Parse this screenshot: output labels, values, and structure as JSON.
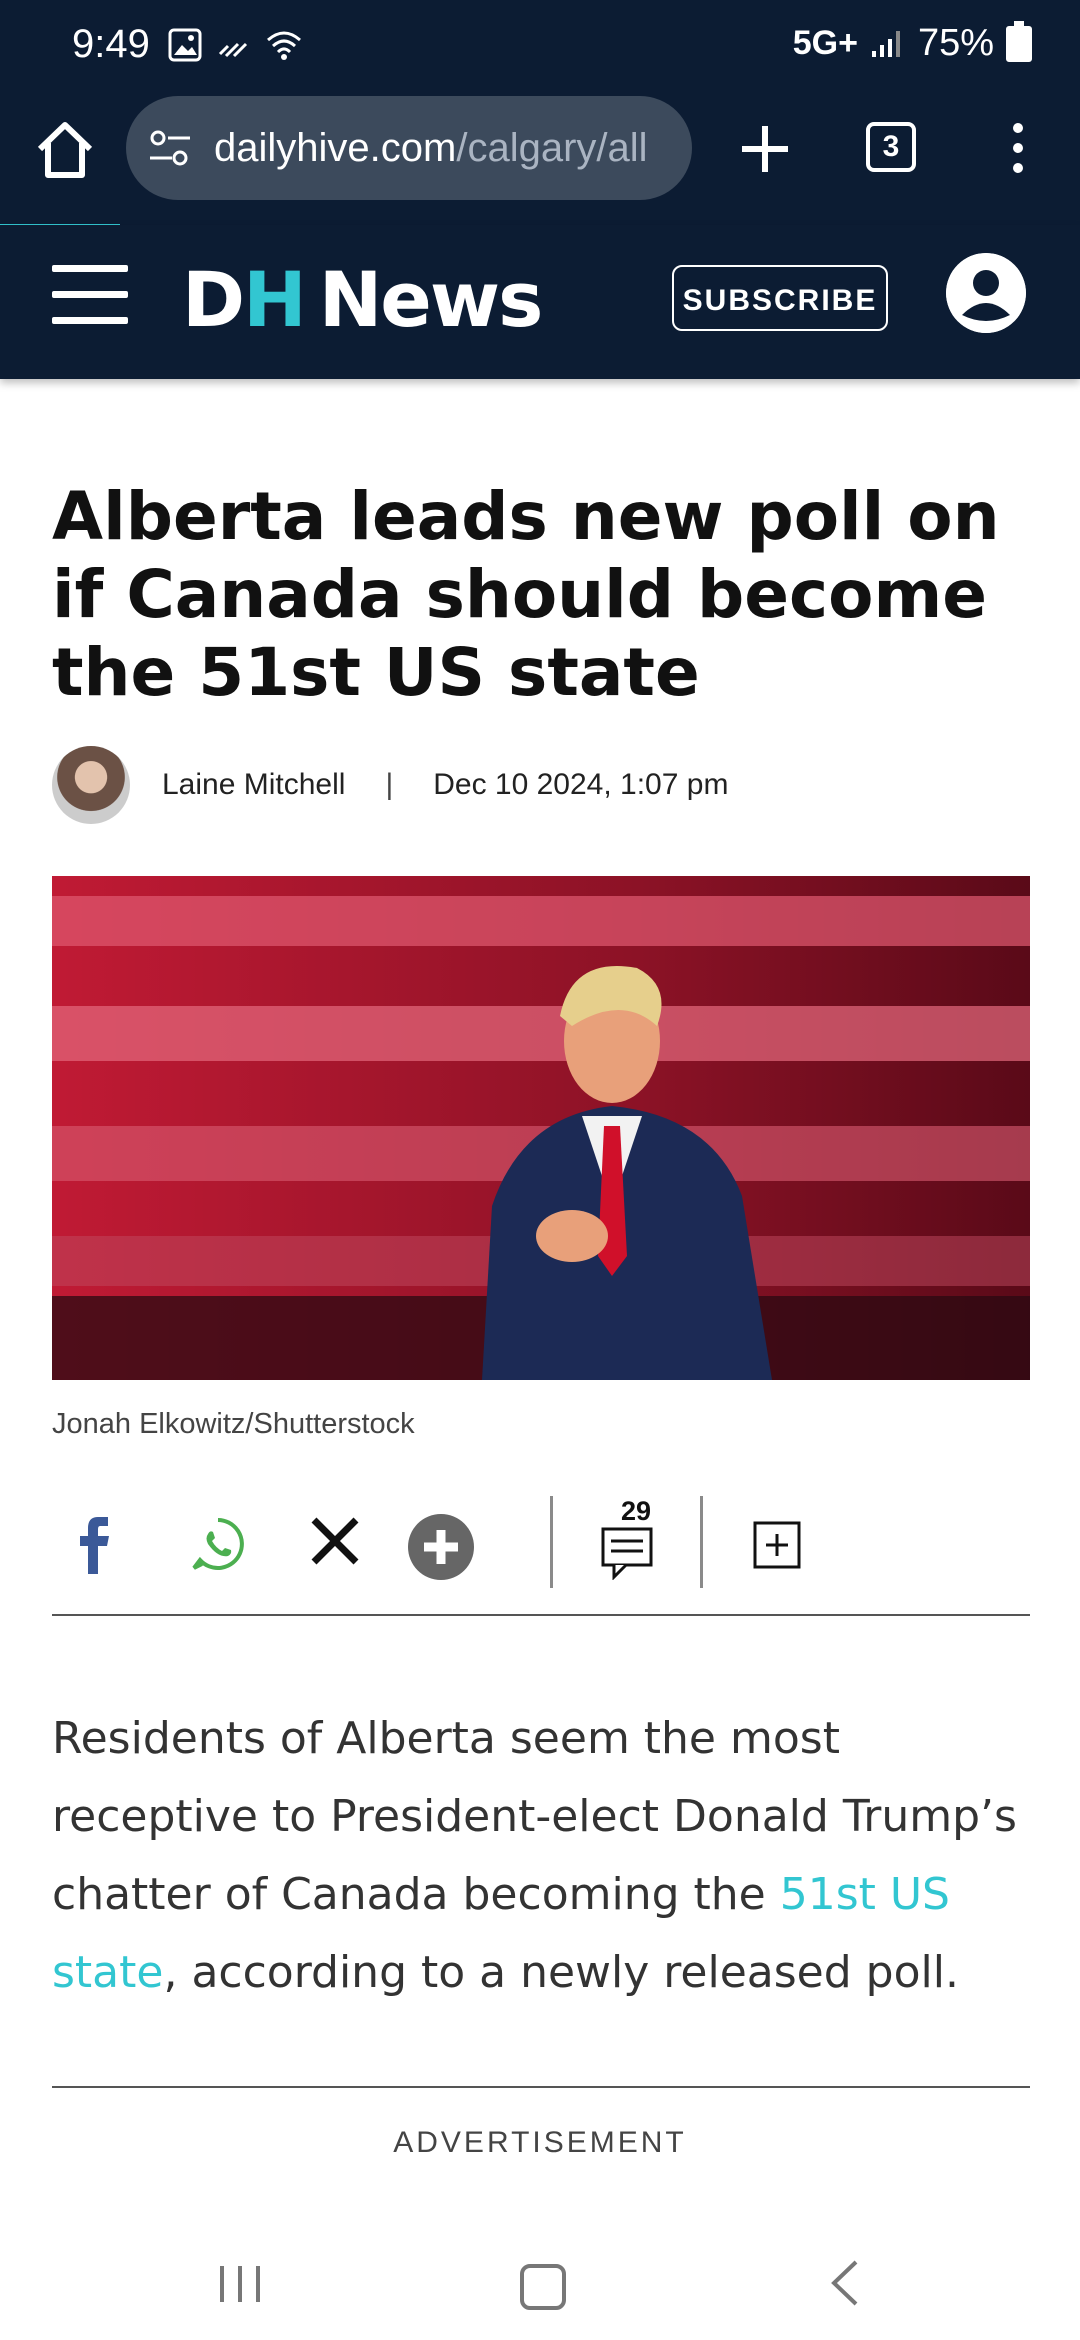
{
  "status_bar": {
    "time": "9:49",
    "network": "5G+",
    "battery": "75%"
  },
  "browser": {
    "url_domain": "dailyhive.com",
    "url_path": "/calgary/all",
    "tab_count": "3"
  },
  "site_header": {
    "logo_d": "D",
    "logo_h": "H",
    "logo_news": "News",
    "subscribe_label": "SUBSCRIBE",
    "accent_color": "#32c6d1",
    "background_color": "#0c1c33"
  },
  "article": {
    "headline": "Alberta leads new poll on if Canada should become the 51st US state",
    "author": "Laine Mitchell",
    "separator": "|",
    "date": "Dec 10 2024, 1:07 pm",
    "image_caption": "Jonah Elkowitz/Shutterstock",
    "comments_count": "29",
    "body_before_link": "Residents of Alberta seem the most receptive to President-elect Donald Trump’s chatter of Canada becoming the ",
    "body_link": "51st US state",
    "body_after_link": ", according to a newly released poll."
  },
  "share": {
    "icons": [
      "facebook-icon",
      "whatsapp-icon",
      "x-icon",
      "more-share-icon",
      "comments-icon",
      "bookmark-add-icon"
    ]
  },
  "advertisement_label": "ADVERTISEMENT"
}
